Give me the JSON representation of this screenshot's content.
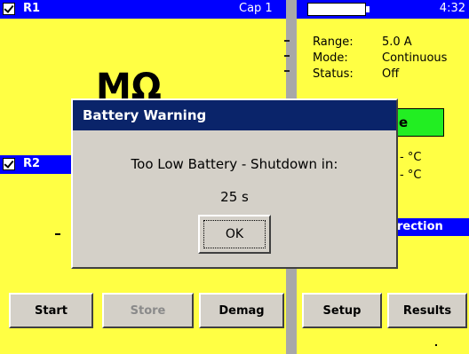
{
  "panel_r1": {
    "label": "R1",
    "cap": "Cap 1",
    "big_reading": "MΩ"
  },
  "panel_r2": {
    "label": "R2"
  },
  "status_bar": {
    "time": "4:32"
  },
  "info": {
    "range_label": "Range:",
    "range_value": "5.0 A",
    "mode_label": "Mode:",
    "mode_value": "Continuous",
    "status_label": "Status:",
    "status_value": "Off",
    "green_partial": "e",
    "temp1": "- °C",
    "temp2": "- °C",
    "direction_partial": "rection"
  },
  "buttons": {
    "start": "Start",
    "store": "Store",
    "demag": "Demag",
    "setup": "Setup",
    "results": "Results"
  },
  "dialog": {
    "title": "Battery Warning",
    "message": "Too Low Battery - Shutdown in:",
    "countdown": "25 s",
    "ok": "OK"
  },
  "colors": {
    "background": "#ffff44",
    "title_bar": "#0000ff",
    "dialog_title": "#0a246a",
    "status_green": "#22ee22"
  }
}
